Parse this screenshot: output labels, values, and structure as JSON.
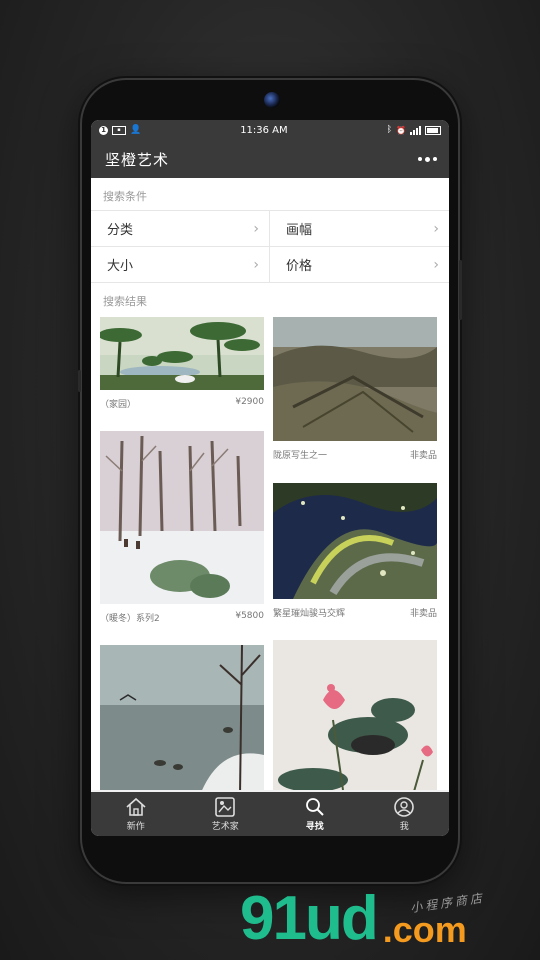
{
  "status_bar": {
    "time": "11:36 AM"
  },
  "header": {
    "title": "坚橙艺术"
  },
  "search": {
    "conditions_label": "搜索条件",
    "filters": [
      {
        "label": "分类"
      },
      {
        "label": "画幅"
      },
      {
        "label": "大小"
      },
      {
        "label": "价格"
      }
    ],
    "results_label": "搜索结果"
  },
  "results": [
    {
      "title": "（家园）",
      "price": "¥2900"
    },
    {
      "title": "陇原写生之一",
      "price": "非卖品"
    },
    {
      "title": "（暖冬）系列2",
      "price": "¥5800"
    },
    {
      "title": "繁星璀灿骏马交辉",
      "price": "非卖品"
    },
    {
      "title": "",
      "price": ""
    },
    {
      "title": "",
      "price": ""
    }
  ],
  "tabbar": {
    "tabs": [
      {
        "label": "新作",
        "icon": "home-icon"
      },
      {
        "label": "艺术家",
        "icon": "artist-icon"
      },
      {
        "label": "寻找",
        "icon": "search-icon"
      },
      {
        "label": "我",
        "icon": "profile-icon"
      }
    ],
    "active": "寻找"
  },
  "watermark": {
    "brand": "91ud",
    "suffix": ".com",
    "tagline": "小程序商店"
  },
  "colors": {
    "bar": "#3a3a3a",
    "watermark_green": "#1fbc8e",
    "watermark_orange": "#f39a1f"
  }
}
